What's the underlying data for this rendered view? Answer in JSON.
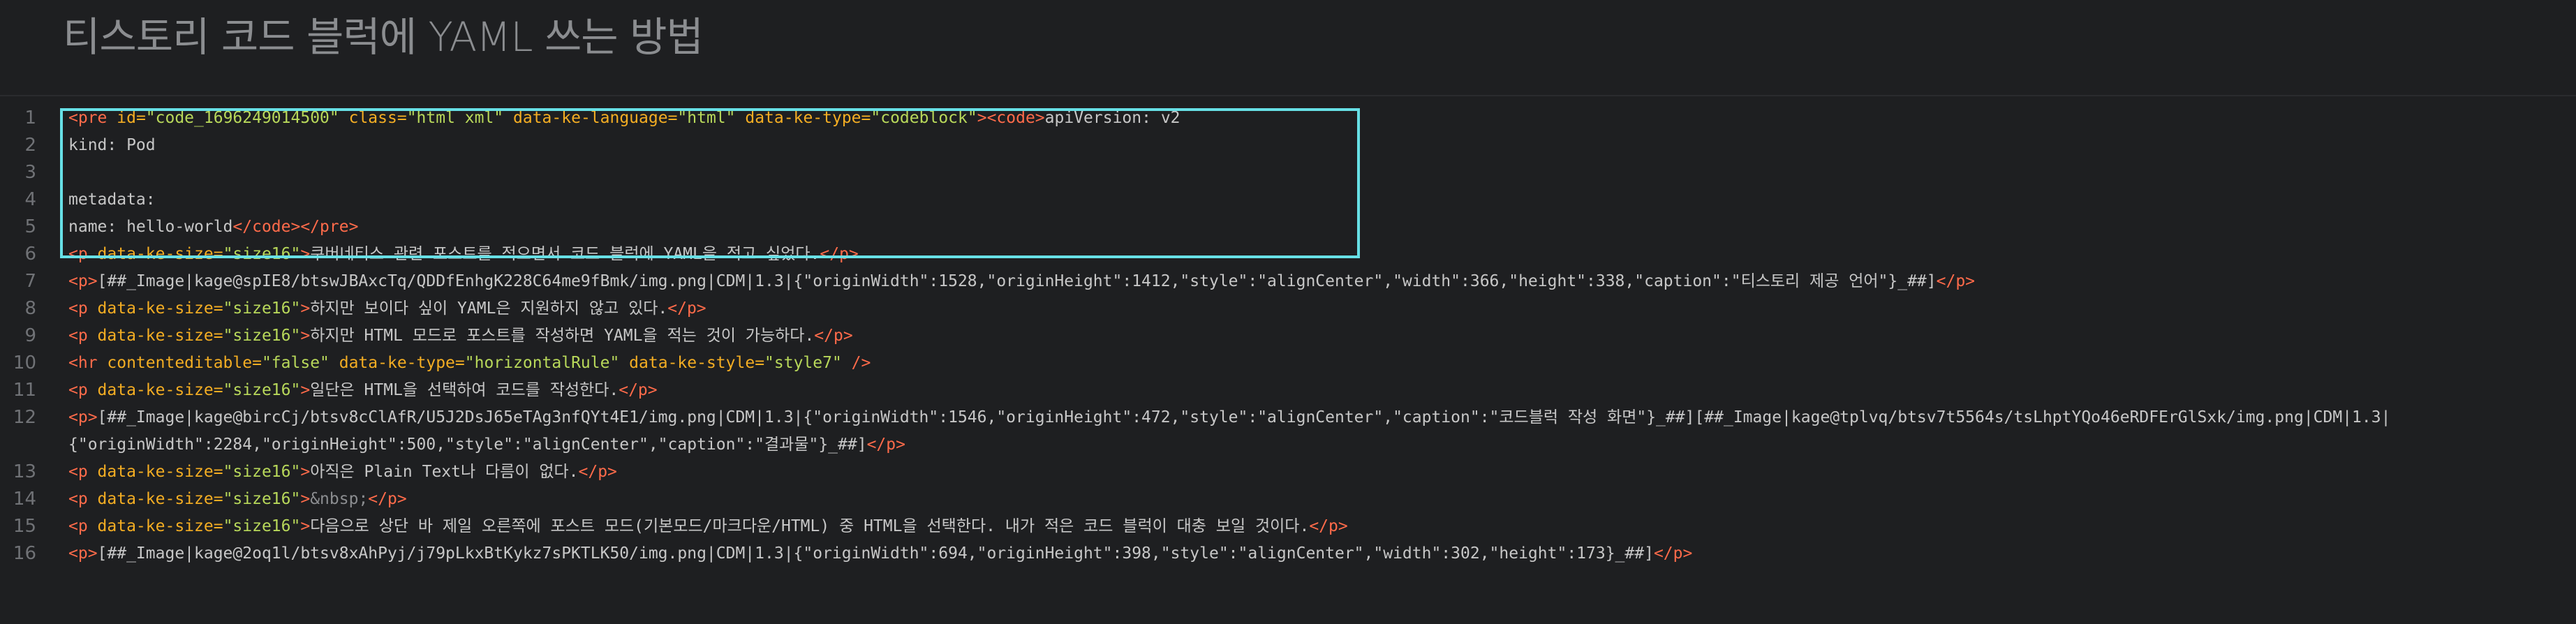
{
  "title": "티스토리 코드 블럭에 YAML 쓰는 방법",
  "colors": {
    "tag": "#ff6b4a",
    "attr": "#f3ad23",
    "string": "#b8d85a",
    "text": "#c7c7c7",
    "selection": "#67e0e6",
    "background": "#1e1f21"
  },
  "lines": [
    {
      "n": "1",
      "tokens": [
        {
          "t": "tag",
          "v": "<pre "
        },
        {
          "t": "attr",
          "v": "id="
        },
        {
          "t": "str",
          "v": "\"code_1696249014500\""
        },
        {
          "t": "attr",
          "v": " class="
        },
        {
          "t": "str",
          "v": "\"html xml\""
        },
        {
          "t": "attr",
          "v": " data-ke-language="
        },
        {
          "t": "str",
          "v": "\"html\""
        },
        {
          "t": "attr",
          "v": " data-ke-type="
        },
        {
          "t": "str",
          "v": "\"codeblock\""
        },
        {
          "t": "tag",
          "v": "><code>"
        },
        {
          "t": "txt",
          "v": "apiVersion: v2"
        }
      ]
    },
    {
      "n": "2",
      "tokens": [
        {
          "t": "txt",
          "v": "kind: Pod"
        }
      ]
    },
    {
      "n": "3",
      "tokens": []
    },
    {
      "n": "4",
      "tokens": [
        {
          "t": "txt",
          "v": "metadata:"
        }
      ]
    },
    {
      "n": "5",
      "tokens": [
        {
          "t": "txt",
          "v": "    name: hello-world"
        },
        {
          "t": "tag",
          "v": "</code></pre>"
        }
      ]
    },
    {
      "n": "6",
      "tokens": [
        {
          "t": "tag",
          "v": "<p "
        },
        {
          "t": "attr",
          "v": "data-ke-size="
        },
        {
          "t": "str",
          "v": "\"size16\""
        },
        {
          "t": "tag",
          "v": ">"
        },
        {
          "t": "txt",
          "v": "쿠버네티스 관련 포스트를 적으면서 코드 블럭에 YAML을 적고 싶었다."
        },
        {
          "t": "tag",
          "v": "</p>"
        }
      ]
    },
    {
      "n": "7",
      "tokens": [
        {
          "t": "tag",
          "v": "<p>"
        },
        {
          "t": "txt",
          "v": "[##_Image|kage@spIE8/btswJBAxcTq/QDDfEnhgK228C64me9fBmk/img.png|CDM|1.3|{\"originWidth\":1528,\"originHeight\":1412,\"style\":\"alignCenter\",\"width\":366,\"height\":338,\"caption\":\"티스토리 제공 언어\"}_##]"
        },
        {
          "t": "tag",
          "v": "</p>"
        }
      ]
    },
    {
      "n": "8",
      "tokens": [
        {
          "t": "tag",
          "v": "<p "
        },
        {
          "t": "attr",
          "v": "data-ke-size="
        },
        {
          "t": "str",
          "v": "\"size16\""
        },
        {
          "t": "tag",
          "v": ">"
        },
        {
          "t": "txt",
          "v": "하지만 보이다 싶이 YAML은 지원하지 않고 있다."
        },
        {
          "t": "tag",
          "v": "</p>"
        }
      ]
    },
    {
      "n": "9",
      "tokens": [
        {
          "t": "tag",
          "v": "<p "
        },
        {
          "t": "attr",
          "v": "data-ke-size="
        },
        {
          "t": "str",
          "v": "\"size16\""
        },
        {
          "t": "tag",
          "v": ">"
        },
        {
          "t": "txt",
          "v": "하지만 HTML 모드로 포스트를 작성하면 YAML을 적는 것이 가능하다."
        },
        {
          "t": "tag",
          "v": "</p>"
        }
      ]
    },
    {
      "n": "10",
      "tokens": [
        {
          "t": "tag",
          "v": "<hr "
        },
        {
          "t": "attr",
          "v": "contenteditable="
        },
        {
          "t": "str",
          "v": "\"false\""
        },
        {
          "t": "attr",
          "v": " data-ke-type="
        },
        {
          "t": "str",
          "v": "\"horizontalRule\""
        },
        {
          "t": "attr",
          "v": " data-ke-style="
        },
        {
          "t": "str",
          "v": "\"style7\""
        },
        {
          "t": "tag",
          "v": " />"
        }
      ]
    },
    {
      "n": "11",
      "tokens": [
        {
          "t": "tag",
          "v": "<p "
        },
        {
          "t": "attr",
          "v": "data-ke-size="
        },
        {
          "t": "str",
          "v": "\"size16\""
        },
        {
          "t": "tag",
          "v": ">"
        },
        {
          "t": "txt",
          "v": "일단은 HTML을 선택하여 코드를 작성한다."
        },
        {
          "t": "tag",
          "v": "</p>"
        }
      ]
    },
    {
      "n": "12",
      "tall": true,
      "tokens": [
        {
          "t": "tag",
          "v": "<p>"
        },
        {
          "t": "txt",
          "v": "[##_Image|kage@bircCj/btsv8cClAfR/U5J2DsJ65eTAg3nfQYt4E1/img.png|CDM|1.3|{\"originWidth\":1546,\"originHeight\":472,\"style\":\"alignCenter\",\"caption\":\"코드블럭 작성 화면\"}_##][##_Image|kage@tplvq/btsv7t5564s/tsLhptYQo46eRDFErGlSxk/img.png|CDM|1.3|"
        }
      ],
      "tokens2": [
        {
          "t": "txt",
          "v": "{\"originWidth\":2284,\"originHeight\":500,\"style\":\"alignCenter\",\"caption\":\"결과물\"}_##]"
        },
        {
          "t": "tag",
          "v": "</p>"
        }
      ]
    },
    {
      "n": "13",
      "tokens": [
        {
          "t": "tag",
          "v": "<p "
        },
        {
          "t": "attr",
          "v": "data-ke-size="
        },
        {
          "t": "str",
          "v": "\"size16\""
        },
        {
          "t": "tag",
          "v": ">"
        },
        {
          "t": "txt",
          "v": "아직은 Plain Text나 다름이 없다."
        },
        {
          "t": "tag",
          "v": "</p>"
        }
      ]
    },
    {
      "n": "14",
      "tokens": [
        {
          "t": "tag",
          "v": "<p "
        },
        {
          "t": "attr",
          "v": "data-ke-size="
        },
        {
          "t": "str",
          "v": "\"size16\""
        },
        {
          "t": "tag",
          "v": ">"
        },
        {
          "t": "ent",
          "v": "&nbsp;"
        },
        {
          "t": "tag",
          "v": "</p>"
        }
      ]
    },
    {
      "n": "15",
      "tokens": [
        {
          "t": "tag",
          "v": "<p "
        },
        {
          "t": "attr",
          "v": "data-ke-size="
        },
        {
          "t": "str",
          "v": "\"size16\""
        },
        {
          "t": "tag",
          "v": ">"
        },
        {
          "t": "txt",
          "v": "다음으로 상단 바 제일 오른쪽에 포스트 모드(기본모드/마크다운/HTML) 중 HTML을 선택한다. 내가 적은 코드 블럭이 대충 보일 것이다."
        },
        {
          "t": "tag",
          "v": "</p>"
        }
      ]
    },
    {
      "n": "16",
      "tokens": [
        {
          "t": "tag",
          "v": "<p>"
        },
        {
          "t": "txt",
          "v": "[##_Image|kage@2oq1l/btsv8xAhPyj/j79pLkxBtKykz7sPKTLK50/img.png|CDM|1.3|{\"originWidth\":694,\"originHeight\":398,\"style\":\"alignCenter\",\"width\":302,\"height\":173}_##]"
        },
        {
          "t": "tag",
          "v": "</p>"
        }
      ]
    }
  ]
}
